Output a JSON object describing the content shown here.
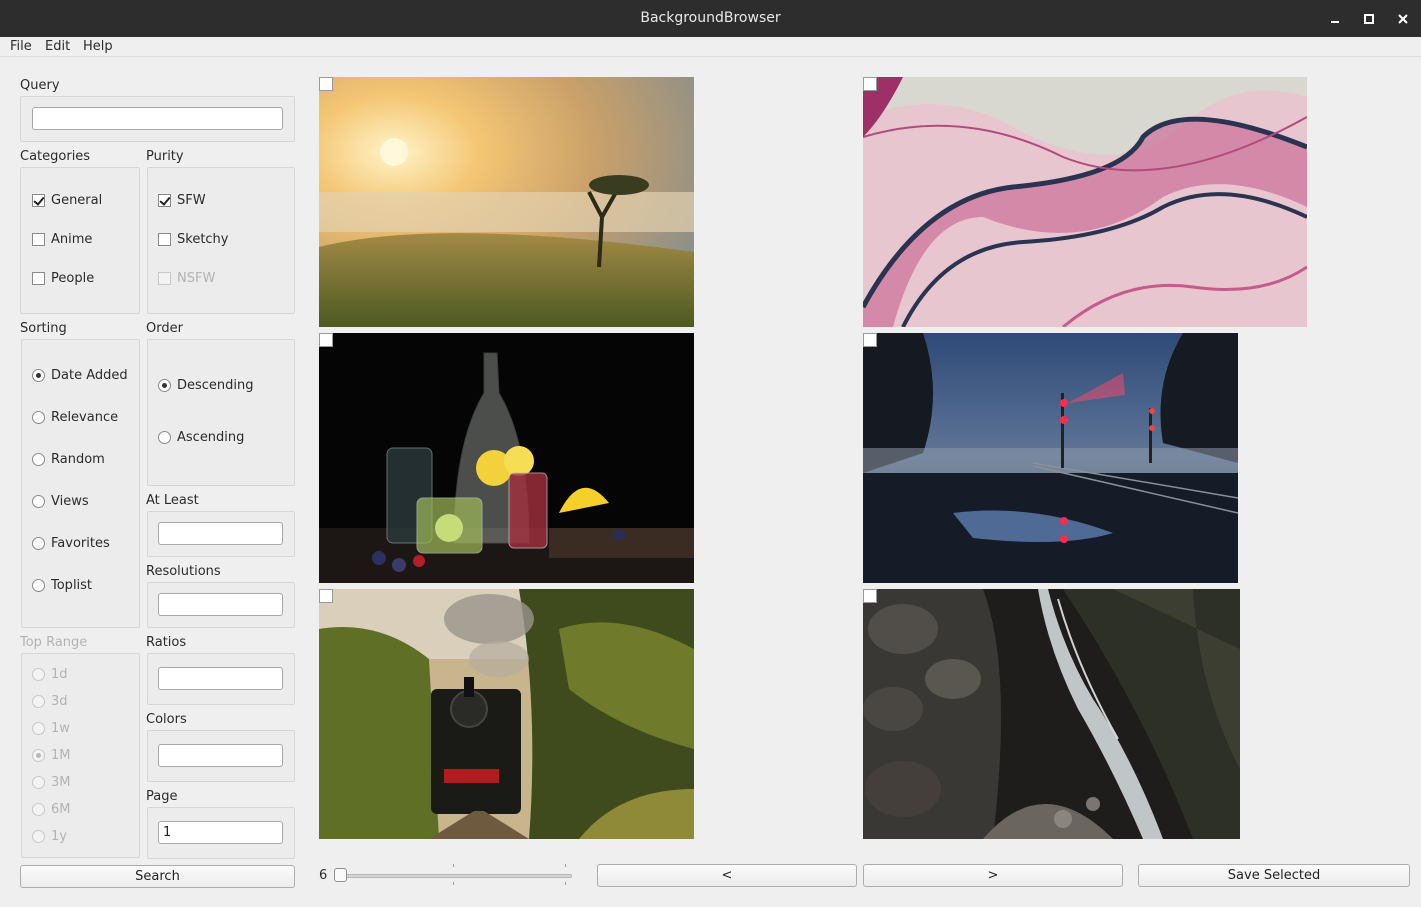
{
  "window": {
    "title": "BackgroundBrowser"
  },
  "menu": [
    "File",
    "Edit",
    "Help"
  ],
  "query": {
    "label": "Query",
    "value": ""
  },
  "categories": {
    "label": "Categories",
    "items": [
      {
        "label": "General",
        "checked": true
      },
      {
        "label": "Anime",
        "checked": false
      },
      {
        "label": "People",
        "checked": false
      }
    ]
  },
  "purity": {
    "label": "Purity",
    "items": [
      {
        "label": "SFW",
        "checked": true
      },
      {
        "label": "Sketchy",
        "checked": false
      },
      {
        "label": "NSFW",
        "checked": false,
        "disabled": true
      }
    ]
  },
  "sorting": {
    "label": "Sorting",
    "items": [
      "Date Added",
      "Relevance",
      "Random",
      "Views",
      "Favorites",
      "Toplist"
    ],
    "selected": "Date Added"
  },
  "order": {
    "label": "Order",
    "items": [
      "Descending",
      "Ascending"
    ],
    "selected": "Descending"
  },
  "top_range": {
    "label": "Top Range",
    "items": [
      "1d",
      "3d",
      "1w",
      "1M",
      "3M",
      "6M",
      "1y"
    ],
    "selected": "1M",
    "disabled": true
  },
  "at_least": {
    "label": "At Least",
    "value": ""
  },
  "resolutions": {
    "label": "Resolutions",
    "value": ""
  },
  "ratios": {
    "label": "Ratios",
    "value": ""
  },
  "colors": {
    "label": "Colors",
    "value": ""
  },
  "page": {
    "label": "Page",
    "value": "1"
  },
  "search_button": "Search",
  "slider": {
    "value": "6"
  },
  "nav": {
    "prev": "<",
    "next": ">",
    "save": "Save Selected"
  },
  "thumbnails": [
    {
      "id": "misty-sunrise-tree"
    },
    {
      "id": "pink-marble-pattern"
    },
    {
      "id": "lemon-water-jars"
    },
    {
      "id": "railway-signals-fog"
    },
    {
      "id": "steam-train-forest"
    },
    {
      "id": "waterfall-rocks"
    }
  ],
  "colors_theme": {
    "titlebar": "#2d2d2d",
    "background": "#efefef"
  }
}
